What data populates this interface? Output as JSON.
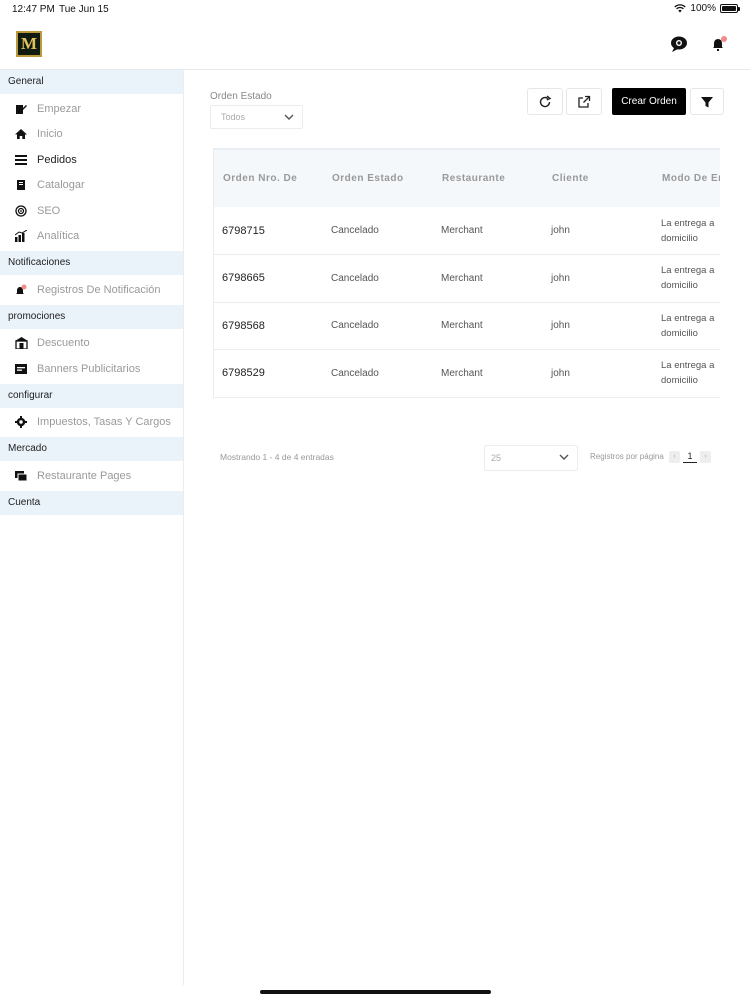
{
  "status_bar": {
    "time": "12:47 PM",
    "date": "Tue Jun 15",
    "battery": "100%"
  },
  "logo": {
    "letter": "M"
  },
  "sidebar": {
    "sections": [
      {
        "header": "General",
        "items": [
          {
            "label": "Empezar",
            "icon": "edit-icon",
            "active": false
          },
          {
            "label": "Inicio",
            "icon": "home-icon",
            "active": false
          },
          {
            "label": "Pedidos",
            "icon": "list-icon",
            "active": true
          },
          {
            "label": "Catalogar",
            "icon": "book-icon",
            "active": false
          },
          {
            "label": "SEO",
            "icon": "target-icon",
            "active": false
          },
          {
            "label": "Analítica",
            "icon": "analytics-icon",
            "active": false
          }
        ]
      },
      {
        "header": "Notificaciones",
        "items": [
          {
            "label": "Registros De Notificación",
            "icon": "notification-icon",
            "active": false
          }
        ]
      },
      {
        "header": "promociones",
        "items": [
          {
            "label": "Descuento",
            "icon": "store-icon",
            "active": false
          },
          {
            "label": "Banners Publicitarios",
            "icon": "banner-icon",
            "active": false
          }
        ]
      },
      {
        "header": "configurar",
        "items": [
          {
            "label": "Impuestos, Tasas Y Cargos",
            "icon": "gear-icon",
            "active": false
          }
        ]
      },
      {
        "header": "Mercado",
        "items": [
          {
            "label": "Restaurante Pages",
            "icon": "pages-icon",
            "active": false
          }
        ]
      },
      {
        "header": "Cuenta",
        "items": []
      }
    ]
  },
  "filters": {
    "status_label": "Orden Estado",
    "status_value": "Todos"
  },
  "toolbar": {
    "create_label": "Crear Orden"
  },
  "table": {
    "columns": [
      "Orden Nro. De",
      "Orden Estado",
      "Restaurante",
      "Cliente",
      "Modo De Entrega"
    ],
    "rows": [
      {
        "id": "6798715",
        "status": "Cancelado",
        "restaurant": "Merchant",
        "client": "john",
        "mode_line1": "La entrega a",
        "mode_line2": "domicilio"
      },
      {
        "id": "6798665",
        "status": "Cancelado",
        "restaurant": "Merchant",
        "client": "john",
        "mode_line1": "La entrega a",
        "mode_line2": "domicilio"
      },
      {
        "id": "6798568",
        "status": "Cancelado",
        "restaurant": "Merchant",
        "client": "john",
        "mode_line1": "La entrega a",
        "mode_line2": "domicilio"
      },
      {
        "id": "6798529",
        "status": "Cancelado",
        "restaurant": "Merchant",
        "client": "john",
        "mode_line1": "La entrega a",
        "mode_line2": "domicilio"
      }
    ]
  },
  "pagination": {
    "summary": "Mostrando 1 - 4 de 4 entradas",
    "page_size": "25",
    "per_page_label": "Registros por página",
    "current_page": "1",
    "prev": "‹",
    "next": "›"
  },
  "colors": {
    "section_bg": "#eaf2fa",
    "header_bg": "#f5f8fb",
    "primary_button": "#000000",
    "logo_gold": "#b89a3a"
  }
}
